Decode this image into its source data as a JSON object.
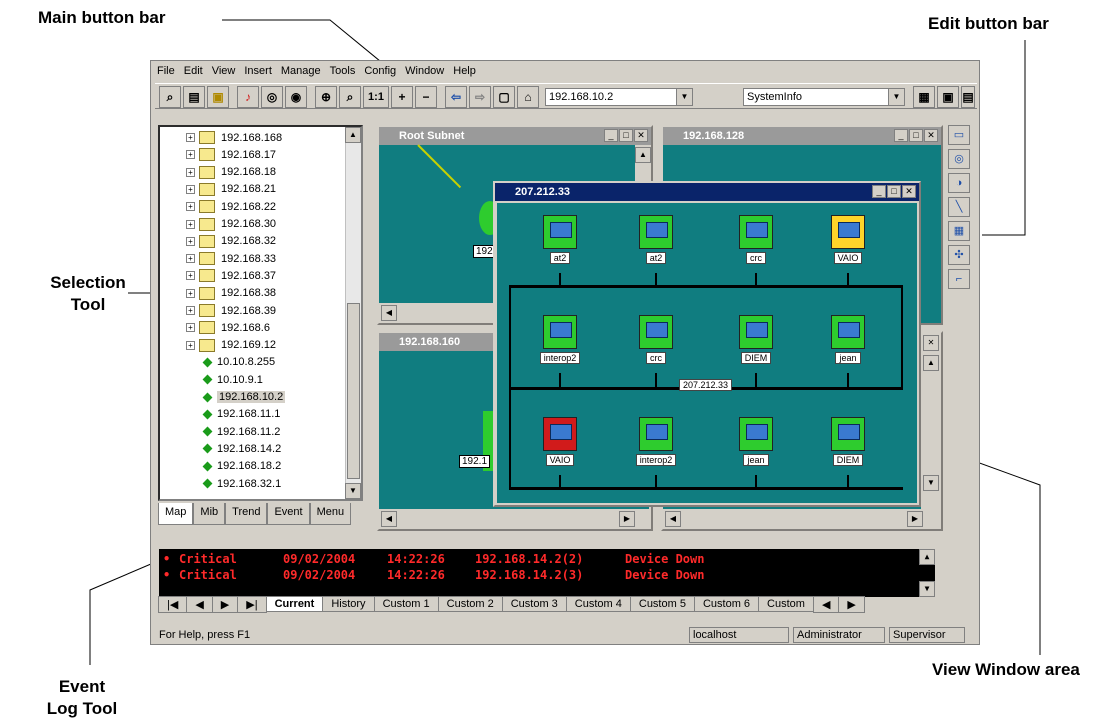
{
  "callouts": {
    "main_button_bar": "Main button bar",
    "edit_button_bar": "Edit button bar",
    "selection_tool": "Selection Tool",
    "view_window_area": "View Window area",
    "event_log_tool": "Event Log Tool"
  },
  "menu": [
    "File",
    "Edit",
    "View",
    "Insert",
    "Manage",
    "Tools",
    "Config",
    "Window",
    "Help"
  ],
  "toolbar": {
    "zoom_label": "1:1",
    "address_value": "192.168.10.2",
    "view_select_value": "SystemInfo"
  },
  "tree": {
    "folders": [
      "192.168.168",
      "192.168.17",
      "192.168.18",
      "192.168.21",
      "192.168.22",
      "192.168.30",
      "192.168.32",
      "192.168.33",
      "192.168.37",
      "192.168.38",
      "192.168.39",
      "192.168.6",
      "192.169.12"
    ],
    "nodes": [
      "10.10.8.255",
      "10.10.9.1",
      "192.168.10.2",
      "192.168.11.1",
      "192.168.11.2",
      "192.168.14.2",
      "192.168.18.2",
      "192.168.32.1"
    ],
    "selected": "192.168.10.2"
  },
  "left_tabs": [
    "Map",
    "Mib",
    "Trend",
    "Event",
    "Menu"
  ],
  "windows": {
    "root_subnet": "Root Subnet",
    "w128": "192.168.128",
    "w160": "192.168.160",
    "w207": "207.212.33",
    "partial_labels": [
      "192",
      "192.1"
    ]
  },
  "network": {
    "bus_label": "207.212.33",
    "row1": [
      {
        "label": "at2",
        "color": "green"
      },
      {
        "label": "at2",
        "color": "green"
      },
      {
        "label": "crc",
        "color": "green"
      },
      {
        "label": "VAIO",
        "color": "yellow"
      }
    ],
    "row2": [
      {
        "label": "interop2",
        "color": "green"
      },
      {
        "label": "crc",
        "color": "green"
      },
      {
        "label": "DIEM",
        "color": "green"
      },
      {
        "label": "jean",
        "color": "green"
      }
    ],
    "row3": [
      {
        "label": "VAIO",
        "color": "red"
      },
      {
        "label": "interop2",
        "color": "green"
      },
      {
        "label": "jean",
        "color": "green"
      },
      {
        "label": "DIEM",
        "color": "green"
      }
    ]
  },
  "event_log": {
    "rows": [
      {
        "severity": "Critical",
        "date": "09/02/2004",
        "time": "14:22:26",
        "source": "192.168.14.2(2)",
        "message": "Device Down"
      },
      {
        "severity": "Critical",
        "date": "09/02/2004",
        "time": "14:22:26",
        "source": "192.168.14.2(3)",
        "message": "Device Down"
      }
    ],
    "tabs": [
      "Current",
      "History",
      "Custom 1",
      "Custom 2",
      "Custom 3",
      "Custom 4",
      "Custom 5",
      "Custom 6",
      "Custom"
    ]
  },
  "status": {
    "help": "For Help, press F1",
    "host": "localhost",
    "user": "Administrator",
    "role": "Supervisor"
  }
}
